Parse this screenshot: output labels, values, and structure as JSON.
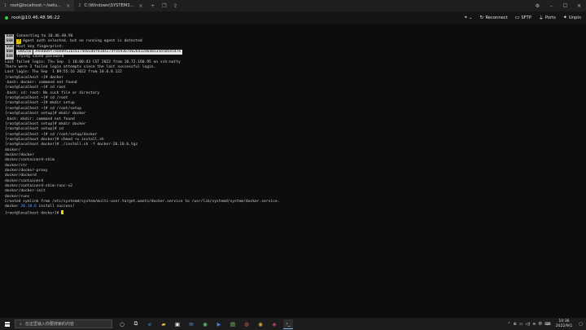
{
  "tabs": [
    {
      "num": "1",
      "label": "root@localhost:~/setu..."
    },
    {
      "num": "2",
      "label": "C:\\Windows\\SYSTEM3..."
    }
  ],
  "session": {
    "host": "root@10.46.48.96:22",
    "status_color": "#3ad14b",
    "actions": {
      "reconnect": "Reconnect",
      "sftp": "SFTP",
      "ports": "Ports",
      "unpin": "Unpin"
    }
  },
  "terminal": {
    "ssh_tag": "SSH",
    "ssh_lines": {
      "connecting": "Connecting to 10.46.48.96",
      "agent_warn": "Agent auth selected, but no running agent is detected",
      "fingerprint_label": "Host key fingerprint:",
      "fp_algorithm": "SHA256",
      "fp_value": "39edb09f7e69d913ac6174e01d6f8184174fd59367e0264324b46535b505e547e",
      "saved_pw": "Trying saved password"
    },
    "lines": [
      "Last failed login: Thu Sep  1 10:00:43 CST 2022 from 10.72.160.95 on ssh:notty",
      "There were 3 failed login attempts since the last successful login.",
      "Last login: Thu Sep  1 09:55:16 2022 from 10.6.8.122",
      "[root@localhost ~]# docker",
      "-bash: docker: command not found",
      "[root@localhost ~]# cd root",
      "-bash: cd: root: No such file or directory",
      "[root@localhost ~]# cd /root",
      "[root@localhost ~]# mkdir setup",
      "[root@localhost ~]# cd /root/setup",
      "[root@localhost setup]# mkdir docker",
      "-bash: mkdir: command not found",
      "[root@localhost setup]# mkdir docker",
      "[root@localhost setup]# cd",
      "[root@localhost ~]# cd /root/setup/docker",
      "[root@localhost docker]# chmod +x install.sh",
      "[root@localhost docker]# ./install.sh -f docker-20.10.6.tgz",
      "docker/",
      "docker/docker",
      "docker/containerd-shim",
      "docker/ctr",
      "docker/docker-proxy",
      "docker/dockerd",
      "docker/containerd",
      "docker/containerd-shim-runc-v2",
      "docker/docker-init",
      "docker/runc",
      "Created symlink from /etc/systemd/system/multi-user.target.wants/docker.service to /usr/lib/systemd/system/docker.service."
    ],
    "install_prefix": "docker ",
    "install_version": "20.10.6",
    "install_suffix": " install success!",
    "final_prompt": "[root@localhost docker]# "
  },
  "taskbar": {
    "search_placeholder": "在这里输入你要搜索的内容",
    "time": "10:36",
    "date": "2022/9/1",
    "ime": "中",
    "accent": "#76b9ed"
  }
}
